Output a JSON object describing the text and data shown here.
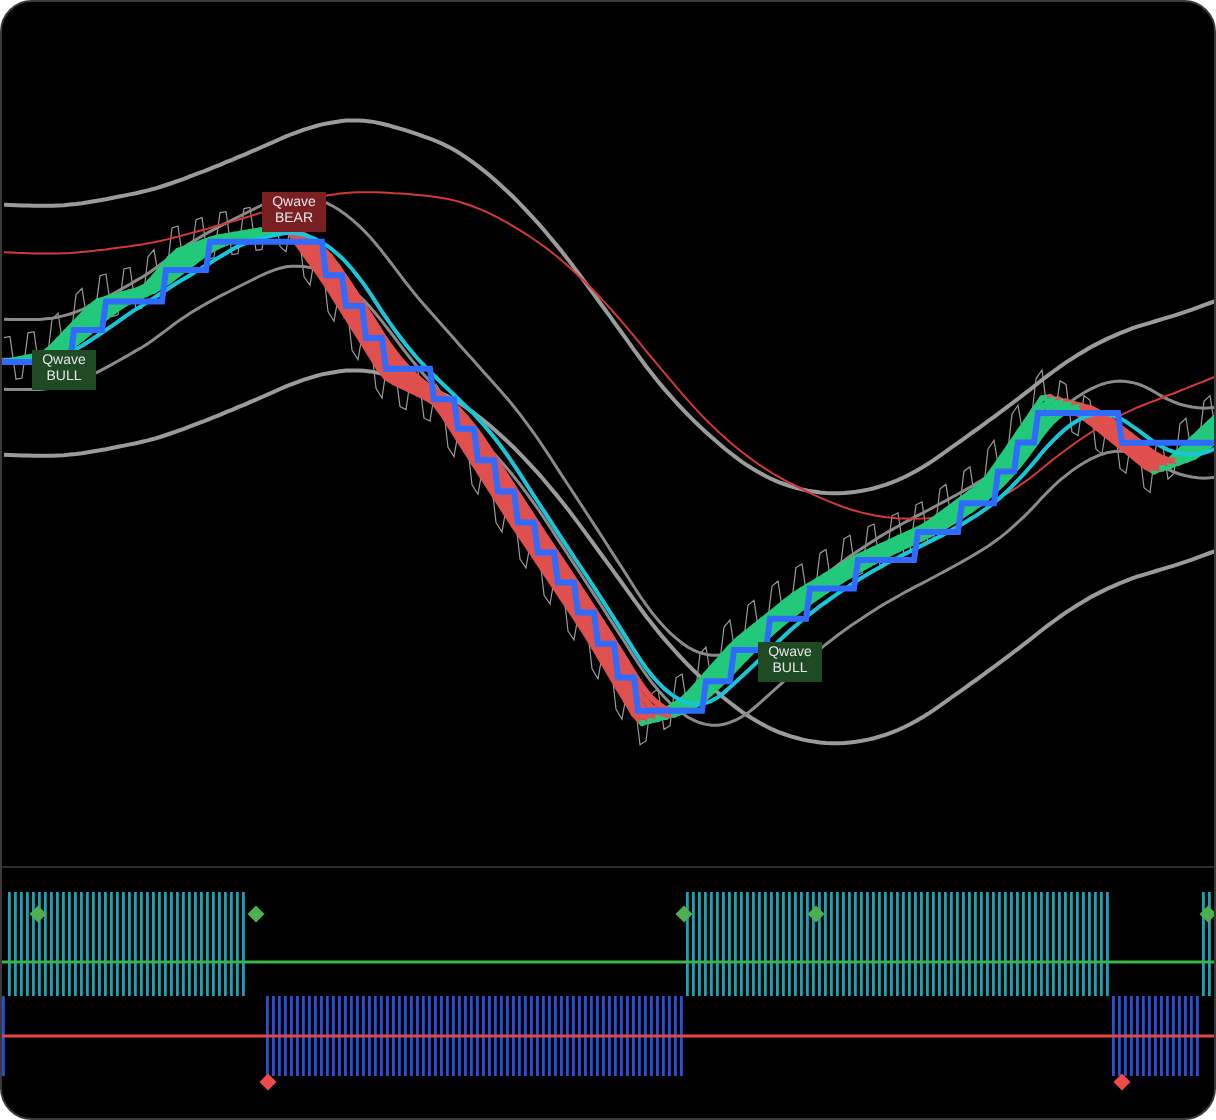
{
  "signals": [
    {
      "kind": "bull",
      "label": "Qwave BULL"
    },
    {
      "kind": "bear",
      "label": "Qwave BEAR"
    },
    {
      "kind": "bull",
      "label": "Qwave BULL"
    }
  ]
}
